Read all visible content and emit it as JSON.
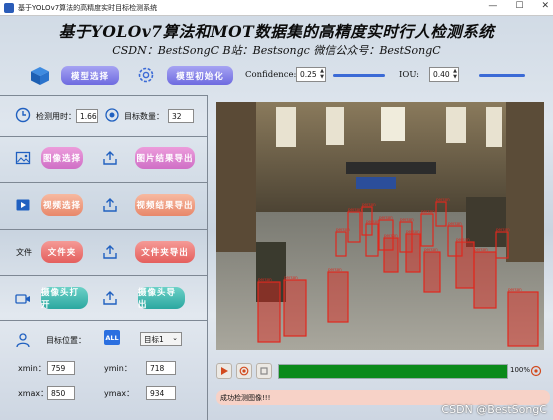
{
  "window": {
    "title": "基于YOLOv7算法的高精度实时目标检测系统",
    "controls": [
      "—",
      "☐",
      "✕"
    ]
  },
  "header": {
    "title": "基于YOLOv7算法和MOT数据集的高精度实时行人检测系统",
    "subtitle": "CSDN：BestSongC  B站：Bestsongc  微信公众号：BestSongC"
  },
  "toolbar": {
    "model_select": "模型选择",
    "model_init": "模型初始化",
    "confidence_label": "Confidence:",
    "confidence_value": "0.25",
    "iou_label": "IOU:",
    "iou_value": "0.40"
  },
  "stats": {
    "time_label": "检测用时：",
    "time_value": "1.66",
    "count_label": "目标数量：",
    "count_value": "32"
  },
  "image_row": {
    "select": "图像选择",
    "export": "图片结果导出"
  },
  "video_row": {
    "select": "视频选择",
    "export": "视频结果导出"
  },
  "folder_row": {
    "icon_text": "文件",
    "select": "文件夹",
    "export": "文件夹导出"
  },
  "camera_row": {
    "open": "摄像头打开",
    "export": "摄像头导出"
  },
  "target": {
    "pos_label": "目标位置：",
    "all_badge": "ALL",
    "select_value": "目标1",
    "xmin_label": "xmin：",
    "xmin_value": "759",
    "ymin_label": "ymin：",
    "ymin_value": "718",
    "xmax_label": "xmax：",
    "xmax_value": "850",
    "ymax_label": "ymax：",
    "ymax_value": "934"
  },
  "player": {
    "progress_percent": 100,
    "progress_text": "100%"
  },
  "status": {
    "message": "成功检测图像!!!"
  },
  "watermark": "CSDN @BestSongC",
  "detections": {
    "label": "person"
  },
  "colors": {
    "accent_purple": "#6d6ae0",
    "progress_green": "#0a8a1a",
    "status_bg": "#f7d2c7",
    "box_red": "#e0281e"
  }
}
